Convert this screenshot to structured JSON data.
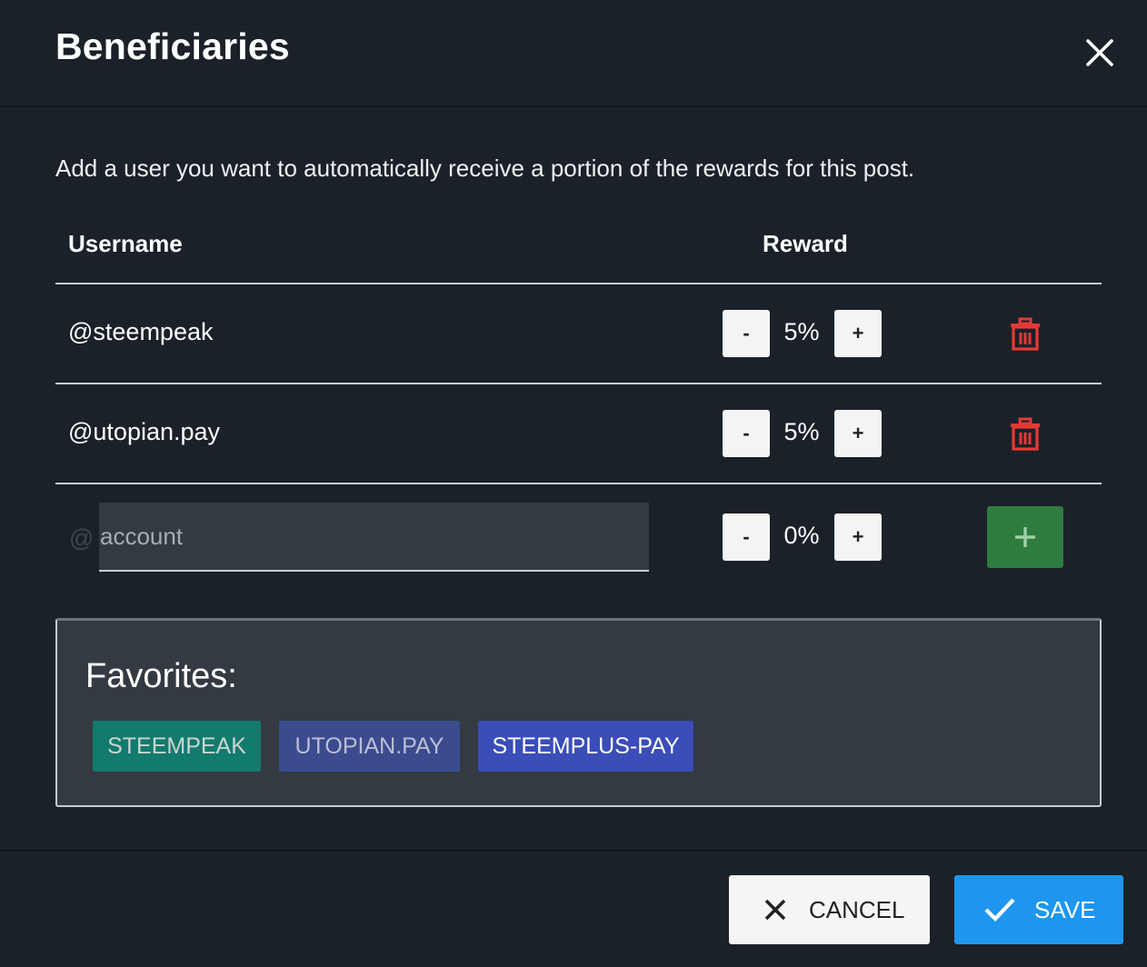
{
  "dialog": {
    "title": "Beneficiaries",
    "close_icon": "close-icon"
  },
  "description": "Add a user you want to automatically receive a portion of the rewards for this post.",
  "table": {
    "headers": {
      "username": "Username",
      "reward": "Reward"
    },
    "rows": [
      {
        "username": "@steempeak",
        "reward": "5%",
        "decrement": "-",
        "increment": "+",
        "delete_icon": "trash-icon"
      },
      {
        "username": "@utopian.pay",
        "reward": "5%",
        "decrement": "-",
        "increment": "+",
        "delete_icon": "trash-icon"
      }
    ],
    "new_row": {
      "prefix": "@",
      "placeholder": "account",
      "value": "",
      "reward": "0%",
      "decrement": "-",
      "increment": "+",
      "add_icon": "plus-icon"
    }
  },
  "favorites": {
    "title": "Favorites:",
    "chips": [
      {
        "label": "STEEMPEAK",
        "color": "#137a6e",
        "text_color": "#c9d6d4"
      },
      {
        "label": "UTOPIAN.PAY",
        "color": "#3c4b8e",
        "text_color": "#b9bfd6"
      },
      {
        "label": "STEEMPLUS-PAY",
        "color": "#3a4db8",
        "text_color": "#ffffff"
      }
    ]
  },
  "footer": {
    "cancel": {
      "label": "CANCEL",
      "icon": "close-icon"
    },
    "save": {
      "label": "SAVE",
      "icon": "check-icon"
    }
  },
  "colors": {
    "background": "#1b2129",
    "danger": "#e53935",
    "success": "#2e7d3e",
    "primary": "#1e96f0"
  }
}
